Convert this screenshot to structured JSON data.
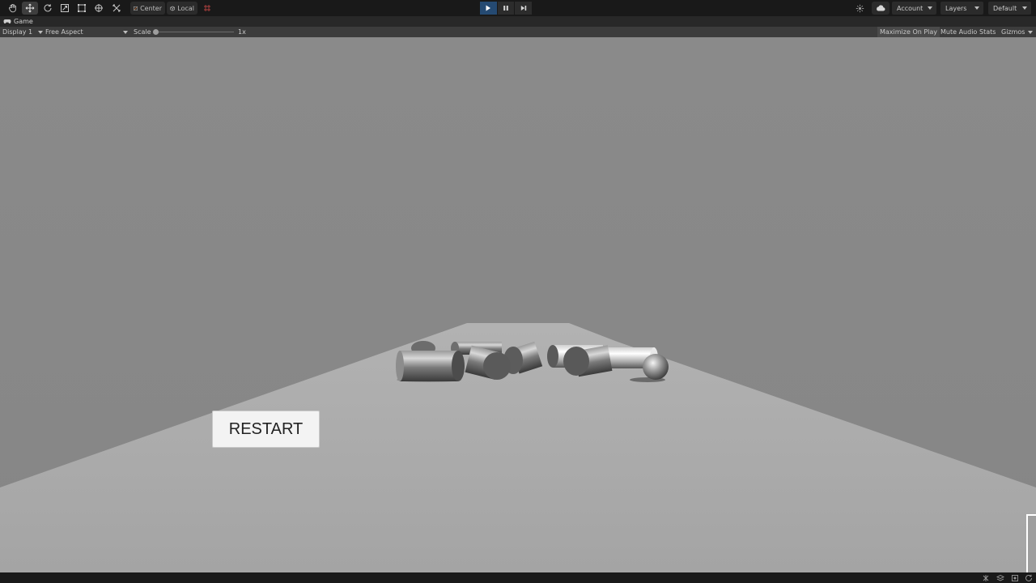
{
  "toolbar": {
    "tools": [
      "hand-tool",
      "move-tool",
      "rotate-tool",
      "scale-tool",
      "rect-tool",
      "transform-tool",
      "custom-tool"
    ],
    "active_tool": "move-tool",
    "pivot_mode": "Center",
    "pivot_rotation": "Local",
    "account_label": "Account",
    "layers_label": "Layers",
    "layout_label": "Default",
    "play_state": "playing"
  },
  "tab": {
    "label": "Game"
  },
  "game_view": {
    "display": "Display 1",
    "aspect": "Free Aspect",
    "scale_label": "Scale",
    "scale_value": "1x",
    "maximize_on_play": "Maximize On Play",
    "mute_audio": "Mute Audio",
    "stats": "Stats",
    "gizmos": "Gizmos"
  },
  "scene": {
    "restart_label": "RESTART",
    "objects": [
      "cylinder",
      "cylinder",
      "cylinder",
      "cylinder",
      "cylinder",
      "cylinder",
      "cylinder",
      "sphere"
    ]
  },
  "colors": {
    "sky": "#8a8a8a",
    "floor": "#a8a8a8",
    "play_active": "#254a72",
    "toolbar_bg": "#191919"
  }
}
